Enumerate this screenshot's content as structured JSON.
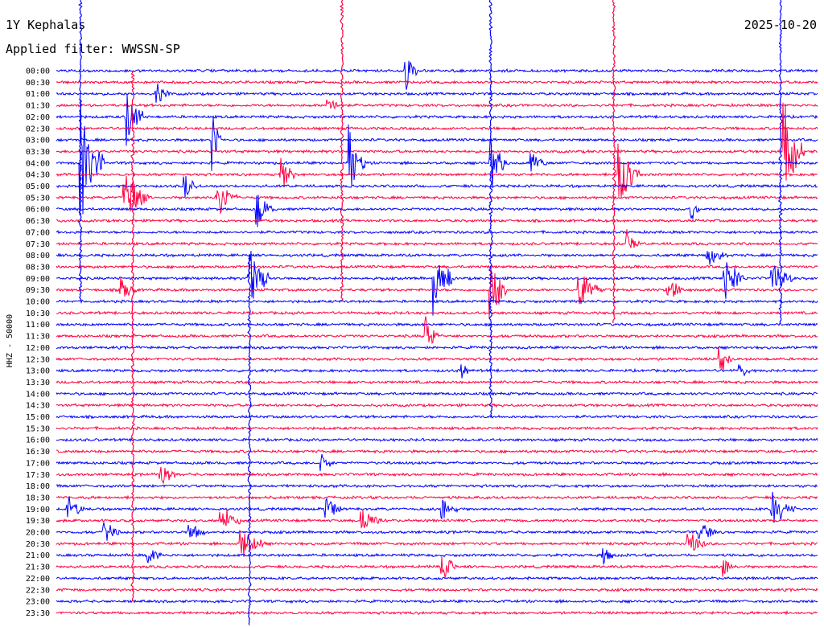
{
  "header": {
    "station": "1Y Kephalas",
    "filter": "Applied filter: WWSSN-SP",
    "date": "2025-10-20"
  },
  "chart_data": {
    "type": "line",
    "title": "1Y Kephalas",
    "subtitle": "Applied filter: WWSSN-SP",
    "date": "2025-10-20",
    "ylabel": "HHZ - 50000",
    "rows": [
      "00:00",
      "00:30",
      "01:00",
      "01:30",
      "02:00",
      "02:30",
      "03:00",
      "03:30",
      "04:00",
      "04:30",
      "05:00",
      "05:30",
      "06:00",
      "06:30",
      "07:00",
      "07:30",
      "08:00",
      "08:30",
      "09:00",
      "09:30",
      "10:00",
      "10:30",
      "11:00",
      "11:30",
      "12:00",
      "12:30",
      "13:00",
      "13:30",
      "14:00",
      "14:30",
      "15:00",
      "15:30",
      "16:00",
      "16:30",
      "17:00",
      "17:30",
      "18:00",
      "18:30",
      "19:00",
      "19:30",
      "20:00",
      "20:30",
      "21:00",
      "21:30",
      "22:00",
      "22:30",
      "23:00",
      "23:30"
    ],
    "row_minutes": 30,
    "grid": false,
    "series": [
      {
        "color": "#0000ff",
        "rows": "even"
      },
      {
        "color": "#ff0040",
        "rows": "odd"
      }
    ]
  }
}
